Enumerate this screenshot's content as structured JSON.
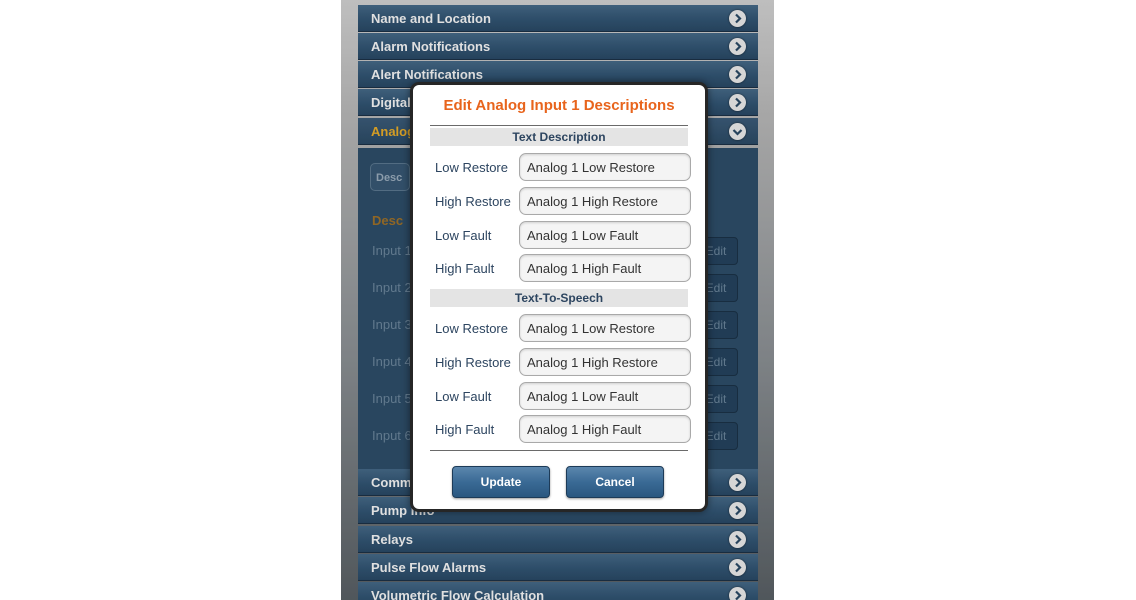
{
  "menu": {
    "items": [
      {
        "label": "Name and Location"
      },
      {
        "label": "Alarm Notifications"
      },
      {
        "label": "Alert Notifications"
      },
      {
        "label": "Digital"
      },
      {
        "label": "Analog"
      },
      {
        "label": "Comm"
      },
      {
        "label": "Pump Info"
      },
      {
        "label": "Relays"
      },
      {
        "label": "Pulse Flow Alarms"
      },
      {
        "label": "Volumetric Flow Calculation"
      }
    ]
  },
  "panel": {
    "tab_label": "Desc",
    "heading": "Desc",
    "rows": [
      {
        "label": "Input 1",
        "edit": "Edit"
      },
      {
        "label": "Input 2",
        "edit": "Edit"
      },
      {
        "label": "Input 3",
        "edit": "Edit"
      },
      {
        "label": "Input 4",
        "edit": "Edit"
      },
      {
        "label": "Input 5",
        "edit": "Edit"
      },
      {
        "label": "Input 6",
        "edit": "Edit"
      }
    ]
  },
  "dialog": {
    "title": "Edit Analog Input 1 Descriptions",
    "text_description": {
      "heading": "Text Description",
      "fields": [
        {
          "label": "Low Restore",
          "value": "Analog 1 Low Restore"
        },
        {
          "label": "High Restore",
          "value": "Analog 1 High Restore"
        },
        {
          "label": "Low Fault",
          "value": "Analog 1 Low Fault"
        },
        {
          "label": "High Fault",
          "value": "Analog 1 High Fault"
        }
      ]
    },
    "text_to_speech": {
      "heading": "Text-To-Speech",
      "fields": [
        {
          "label": "Low Restore",
          "value": "Analog 1 Low Restore"
        },
        {
          "label": "High Restore",
          "value": "Analog 1 High Restore"
        },
        {
          "label": "Low Fault",
          "value": "Analog 1 Low Fault"
        },
        {
          "label": "High Fault",
          "value": "Analog 1 High Fault"
        }
      ]
    },
    "update_label": "Update",
    "cancel_label": "Cancel"
  },
  "colors": {
    "accent_title": "#e8641c",
    "active_menu": "#f2b32a",
    "menu_bg": "#345878"
  }
}
